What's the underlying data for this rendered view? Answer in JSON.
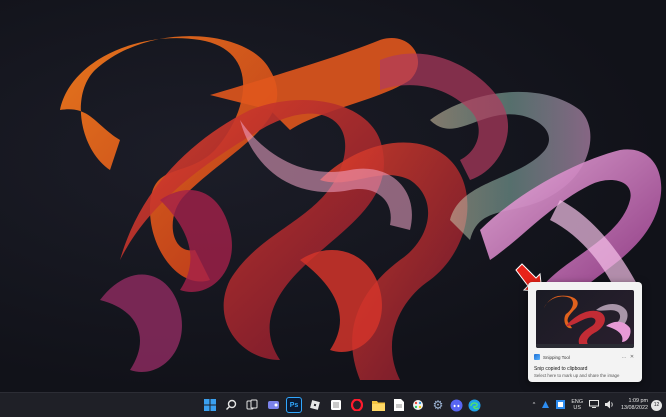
{
  "notification": {
    "app_name": "Snipping Tool",
    "title": "Snip copied to clipboard",
    "subtitle": "Select here to mark up and share the image",
    "more_glyph": "…",
    "close_glyph": "✕"
  },
  "taskbar": {
    "icons": [
      {
        "name": "start-button",
        "icon": "windows-logo-icon",
        "glyph": ""
      },
      {
        "name": "search-button",
        "icon": "search-icon",
        "glyph": ""
      },
      {
        "name": "task-view-button",
        "icon": "task-view-icon",
        "glyph": ""
      },
      {
        "name": "chat-button",
        "icon": "teams-chat-icon",
        "glyph": ""
      },
      {
        "name": "photoshop-button",
        "icon": "photoshop-icon",
        "glyph": "Ps"
      },
      {
        "name": "roblox-button",
        "icon": "roblox-icon",
        "glyph": ""
      },
      {
        "name": "app-button",
        "icon": "app-icon",
        "glyph": ""
      },
      {
        "name": "opera-button",
        "icon": "opera-icon",
        "glyph": "O"
      },
      {
        "name": "file-explorer-button",
        "icon": "folder-icon",
        "glyph": ""
      },
      {
        "name": "notepad-button",
        "icon": "document-icon",
        "glyph": ""
      },
      {
        "name": "paint-button",
        "icon": "paint-icon",
        "glyph": ""
      },
      {
        "name": "settings-button",
        "icon": "gear-icon",
        "glyph": "⚙"
      },
      {
        "name": "discord-button",
        "icon": "discord-icon",
        "glyph": ""
      },
      {
        "name": "edge-button",
        "icon": "edge-icon",
        "glyph": ""
      }
    ],
    "tray": {
      "chevron": "^",
      "lang_line1": "ENG",
      "lang_line2": "US",
      "time": "1:09 pm",
      "date": "13/08/2022",
      "notif_count": "12"
    }
  },
  "colors": {
    "accent_red": "#e8231a",
    "taskbar": "#1f2027"
  }
}
